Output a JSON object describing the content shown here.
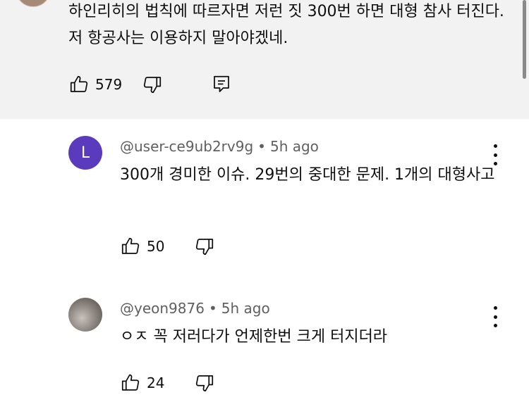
{
  "parent_comment": {
    "text": "하인리히의 법칙에 따르자면 저런 짓 300번 하면 대형 참사 터진다. 저 항공사는 이용하지 말아야겠네.",
    "likes": "579"
  },
  "replies": [
    {
      "avatar_letter": "L",
      "author": "@user-ce9ub2rv9g",
      "time": "5h ago",
      "text": "300개 경미한 이슈. 29번의 중대한 문제. 1개의 대형사고",
      "likes": "50"
    },
    {
      "author": "@yeon9876",
      "time": "5h ago",
      "text": "ㅇㅈ 꼭 저러다가 언제한번 크게 터지더라",
      "likes": "24"
    }
  ],
  "icons": {
    "like": "thumbs-up-icon",
    "dislike": "thumbs-down-icon",
    "reply": "reply-icon",
    "more": "more-vertical-icon"
  },
  "colors": {
    "parent_bg": "#f2f2f2",
    "avatar_l": "#5b3bbd",
    "meta_text": "#606060"
  }
}
